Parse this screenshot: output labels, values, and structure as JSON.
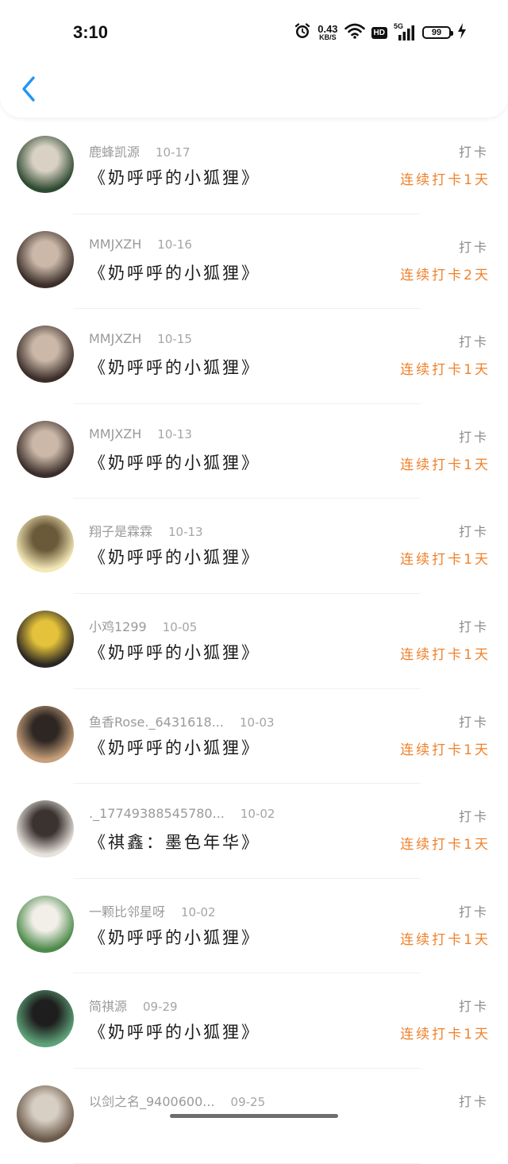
{
  "status_bar": {
    "time": "3:10",
    "net_speed": "0.43",
    "net_unit": "KB/S",
    "hd": "HD",
    "signal": "5G",
    "battery": "99"
  },
  "colors": {
    "accent_blue": "#2196f3",
    "streak_orange": "#f0812a",
    "text_gray": "#9a9a9a"
  },
  "icons": {
    "back": "back-chevron-icon",
    "alarm": "alarm-icon",
    "wifi": "wifi-icon",
    "signal": "signal-bars-icon",
    "charging": "charging-bolt-icon"
  },
  "entries": [
    {
      "name": "鹿蜂凯源",
      "date": "10-17",
      "title": "《奶呼呼的小狐狸》",
      "checkin": "打卡",
      "streak": "连续打卡1天",
      "avatar_colors": [
        "#2f4a32",
        "#d9d2c4"
      ]
    },
    {
      "name": "MMJXZH",
      "date": "10-16",
      "title": "《奶呼呼的小狐狸》",
      "checkin": "打卡",
      "streak": "连续打卡2天",
      "avatar_colors": [
        "#3b2e2a",
        "#cbb8a8"
      ]
    },
    {
      "name": "MMJXZH",
      "date": "10-15",
      "title": "《奶呼呼的小狐狸》",
      "checkin": "打卡",
      "streak": "连续打卡1天",
      "avatar_colors": [
        "#3b2e2a",
        "#cbb8a8"
      ]
    },
    {
      "name": "MMJXZH",
      "date": "10-13",
      "title": "《奶呼呼的小狐狸》",
      "checkin": "打卡",
      "streak": "连续打卡1天",
      "avatar_colors": [
        "#3b2e2a",
        "#cbb8a8"
      ]
    },
    {
      "name": "翔子是霖霖",
      "date": "10-13",
      "title": "《奶呼呼的小狐狸》",
      "checkin": "打卡",
      "streak": "连续打卡1天",
      "avatar_colors": [
        "#f3e7b5",
        "#6b5a3a"
      ]
    },
    {
      "name": "小鸡1299",
      "date": "10-05",
      "title": "《奶呼呼的小狐狸》",
      "checkin": "打卡",
      "streak": "连续打卡1天",
      "avatar_colors": [
        "#2a2622",
        "#e4c23b"
      ]
    },
    {
      "name": "鱼香Rose._6431618...",
      "date": "10-03",
      "title": "《奶呼呼的小狐狸》",
      "checkin": "打卡",
      "streak": "连续打卡1天",
      "avatar_colors": [
        "#c7a07a",
        "#2d2622"
      ]
    },
    {
      "name": "._17749388545780...",
      "date": "10-02",
      "title": "《祺鑫：墨色年华》",
      "checkin": "打卡",
      "streak": "连续打卡1天",
      "avatar_colors": [
        "#e8e2dc",
        "#3a3330"
      ]
    },
    {
      "name": "一颗比邻星呀",
      "date": "10-02",
      "title": "《奶呼呼的小狐狸》",
      "checkin": "打卡",
      "streak": "连续打卡1天",
      "avatar_colors": [
        "#4d8a4a",
        "#f2efe9"
      ]
    },
    {
      "name": "简祺源",
      "date": "09-29",
      "title": "《奶呼呼的小狐狸》",
      "checkin": "打卡",
      "streak": "连续打卡1天",
      "avatar_colors": [
        "#5ea278",
        "#1e1e1e"
      ]
    },
    {
      "name": "以剑之名_9400600...",
      "date": "09-25",
      "title": "",
      "checkin": "打卡",
      "streak": "",
      "avatar_colors": [
        "#6b5a4a",
        "#d8cfc4"
      ]
    }
  ]
}
